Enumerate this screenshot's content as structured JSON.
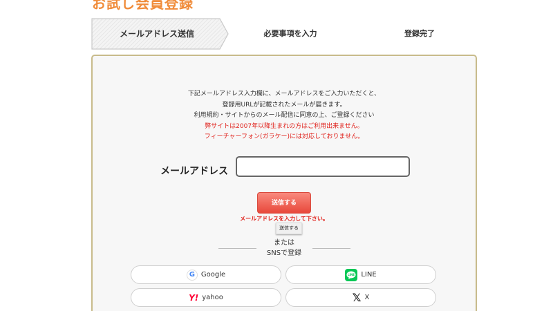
{
  "page": {
    "title": "お試し会員登録"
  },
  "steps": [
    {
      "label": "メールアドレス送信"
    },
    {
      "label": "必要事項を入力"
    },
    {
      "label": "登録完了"
    }
  ],
  "notice": {
    "line1": "下記メールアドレス入力欄に、メールアドレスをご入力いただくと、",
    "line2": "登録用URLが記載されたメールが届きます。",
    "line3": "利用規約・サイトからのメール配信に同意の上、ご登録ください",
    "warning1": "弊サイトは2007年以降生まれの方はご利用出来ません。",
    "warning2": "フィーチャーフォン(ガラケー)には対応しておりません。"
  },
  "form": {
    "email_label": "メールアドレス",
    "email_value": "",
    "submit_label": "送信する",
    "error": "メールアドレスを入力して下さい。",
    "tooltip": "送信する"
  },
  "sns": {
    "or": "または",
    "register": "SNSで登録",
    "buttons": [
      {
        "label": "Google",
        "icon": "google-icon"
      },
      {
        "label": "LINE",
        "icon": "line-icon"
      },
      {
        "label": "yahoo",
        "icon": "yahoo-icon"
      },
      {
        "label": "X",
        "icon": "x-icon"
      }
    ]
  },
  "colors": {
    "title": "#f08c3a",
    "accent_red": "#e0201a",
    "panel_border": "#c8bb8b",
    "line_green": "#06c755"
  }
}
